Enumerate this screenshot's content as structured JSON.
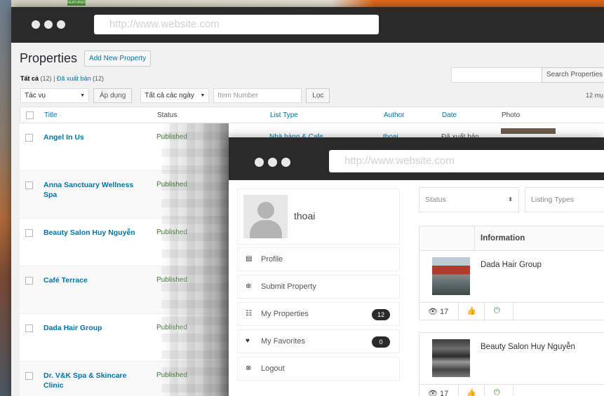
{
  "background": {
    "featured_label": "FEATURED"
  },
  "window1": {
    "url": "http://www.website.com",
    "page_title": "Properties",
    "add_new_label": "Add New Property",
    "subsub": {
      "all_label": "Tất cả",
      "all_count": "(12)",
      "separator": "|",
      "published_label": "Đã xuất bản",
      "published_count": "(12)"
    },
    "search_button": "Search Properties",
    "filters": {
      "bulk_action": "Tác vụ",
      "apply": "Áp dụng",
      "dates": "Tất cả các ngày",
      "item_number_placeholder": "Item Number",
      "filter": "Lọc",
      "count": "12 mụ"
    },
    "columns": {
      "title": "Title",
      "status": "Status",
      "list_type": "List Type",
      "author": "Author",
      "date": "Date",
      "photo": "Photo"
    },
    "rows": [
      {
        "title": "Angel In Us",
        "status": "Published",
        "type": "Nhà hàng & Cafe",
        "author": "thoai",
        "date": "Đã xuất bản"
      },
      {
        "title": "Anna Sanctuary Wellness Spa",
        "status": "Published",
        "type": "",
        "author": "",
        "date": ""
      },
      {
        "title": "Beauty Salon Huy Nguyễn",
        "status": "Published",
        "type": "",
        "author": "",
        "date": ""
      },
      {
        "title": "Café Terrace",
        "status": "Published",
        "type": "",
        "author": "",
        "date": ""
      },
      {
        "title": "Dada Hair Group",
        "status": "Published",
        "type": "",
        "author": "",
        "date": ""
      },
      {
        "title": "Dr. V&K Spa & Skincare Clinic",
        "status": "Published",
        "type": "",
        "author": "",
        "date": ""
      }
    ]
  },
  "window2": {
    "url": "http://www.website.com",
    "user": {
      "name": "thoai"
    },
    "menu": [
      {
        "label": "Profile",
        "icon": "document-icon",
        "badge": ""
      },
      {
        "label": "Submit Property",
        "icon": "plus-circle-icon",
        "badge": ""
      },
      {
        "label": "My Properties",
        "icon": "list-icon",
        "badge": "12"
      },
      {
        "label": "My Favorites",
        "icon": "heart-icon",
        "badge": "0"
      },
      {
        "label": "Logout",
        "icon": "close-circle-icon",
        "badge": ""
      }
    ],
    "status_filter": "Status",
    "listing_types_filter": "Listing Types",
    "information_header": "Information",
    "listings": [
      {
        "name": "Dada Hair Group",
        "views": "17"
      },
      {
        "name": "Beauty Salon Huy Nguyễn",
        "views": "17"
      }
    ]
  },
  "colors": {
    "link": "#0073aa",
    "published": "#3c7a2c",
    "titlebar": "#2a2a2a",
    "accent_orange": "#e36a1c"
  }
}
